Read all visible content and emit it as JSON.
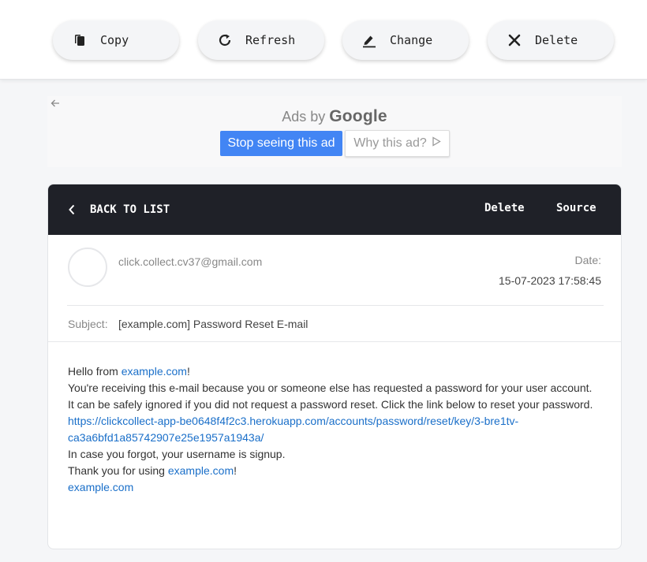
{
  "toolbar": {
    "buttons": [
      {
        "label": "Copy",
        "icon": "copy-icon"
      },
      {
        "label": "Refresh",
        "icon": "refresh-icon"
      },
      {
        "label": "Change",
        "icon": "edit-icon"
      },
      {
        "label": "Delete",
        "icon": "close-icon"
      }
    ]
  },
  "ad": {
    "ads_by": "Ads by",
    "google": "Google",
    "stop_label": "Stop seeing this ad",
    "why_label": "Why this ad?"
  },
  "mail": {
    "back_label": "BACK TO LIST",
    "delete_label": "Delete",
    "source_label": "Source",
    "from": "click.collect.cv37@gmail.com",
    "date_label": "Date:",
    "date_value": "15-07-2023 17:58:45",
    "subject_label": "Subject:",
    "subject_value": "[example.com] Password Reset E-mail",
    "body": {
      "hello_prefix": "Hello from ",
      "site_link": "example.com",
      "hello_suffix": "!",
      "line2": "You're receiving this e-mail because you or someone else has requested a password for your user account.",
      "line3": "It can be safely ignored if you did not request a password reset. Click the link below to reset your password.",
      "reset_link_1": "https://clickcollect-app-be0648f4f2c3.herokuapp.com/accounts/password/reset/key/3-bre1tv-",
      "reset_link_2": "ca3a6bfd1a85742907e25e1957a1943a/",
      "line5": "In case you forgot, your username is signup.",
      "thanks_prefix": "Thank you for using ",
      "thanks_link": "example.com",
      "thanks_suffix": "!",
      "footer_link": "example.com"
    }
  },
  "colors": {
    "header_bg": "#1f2128",
    "link": "#1a6fc9",
    "ad_button": "#4285f4"
  }
}
